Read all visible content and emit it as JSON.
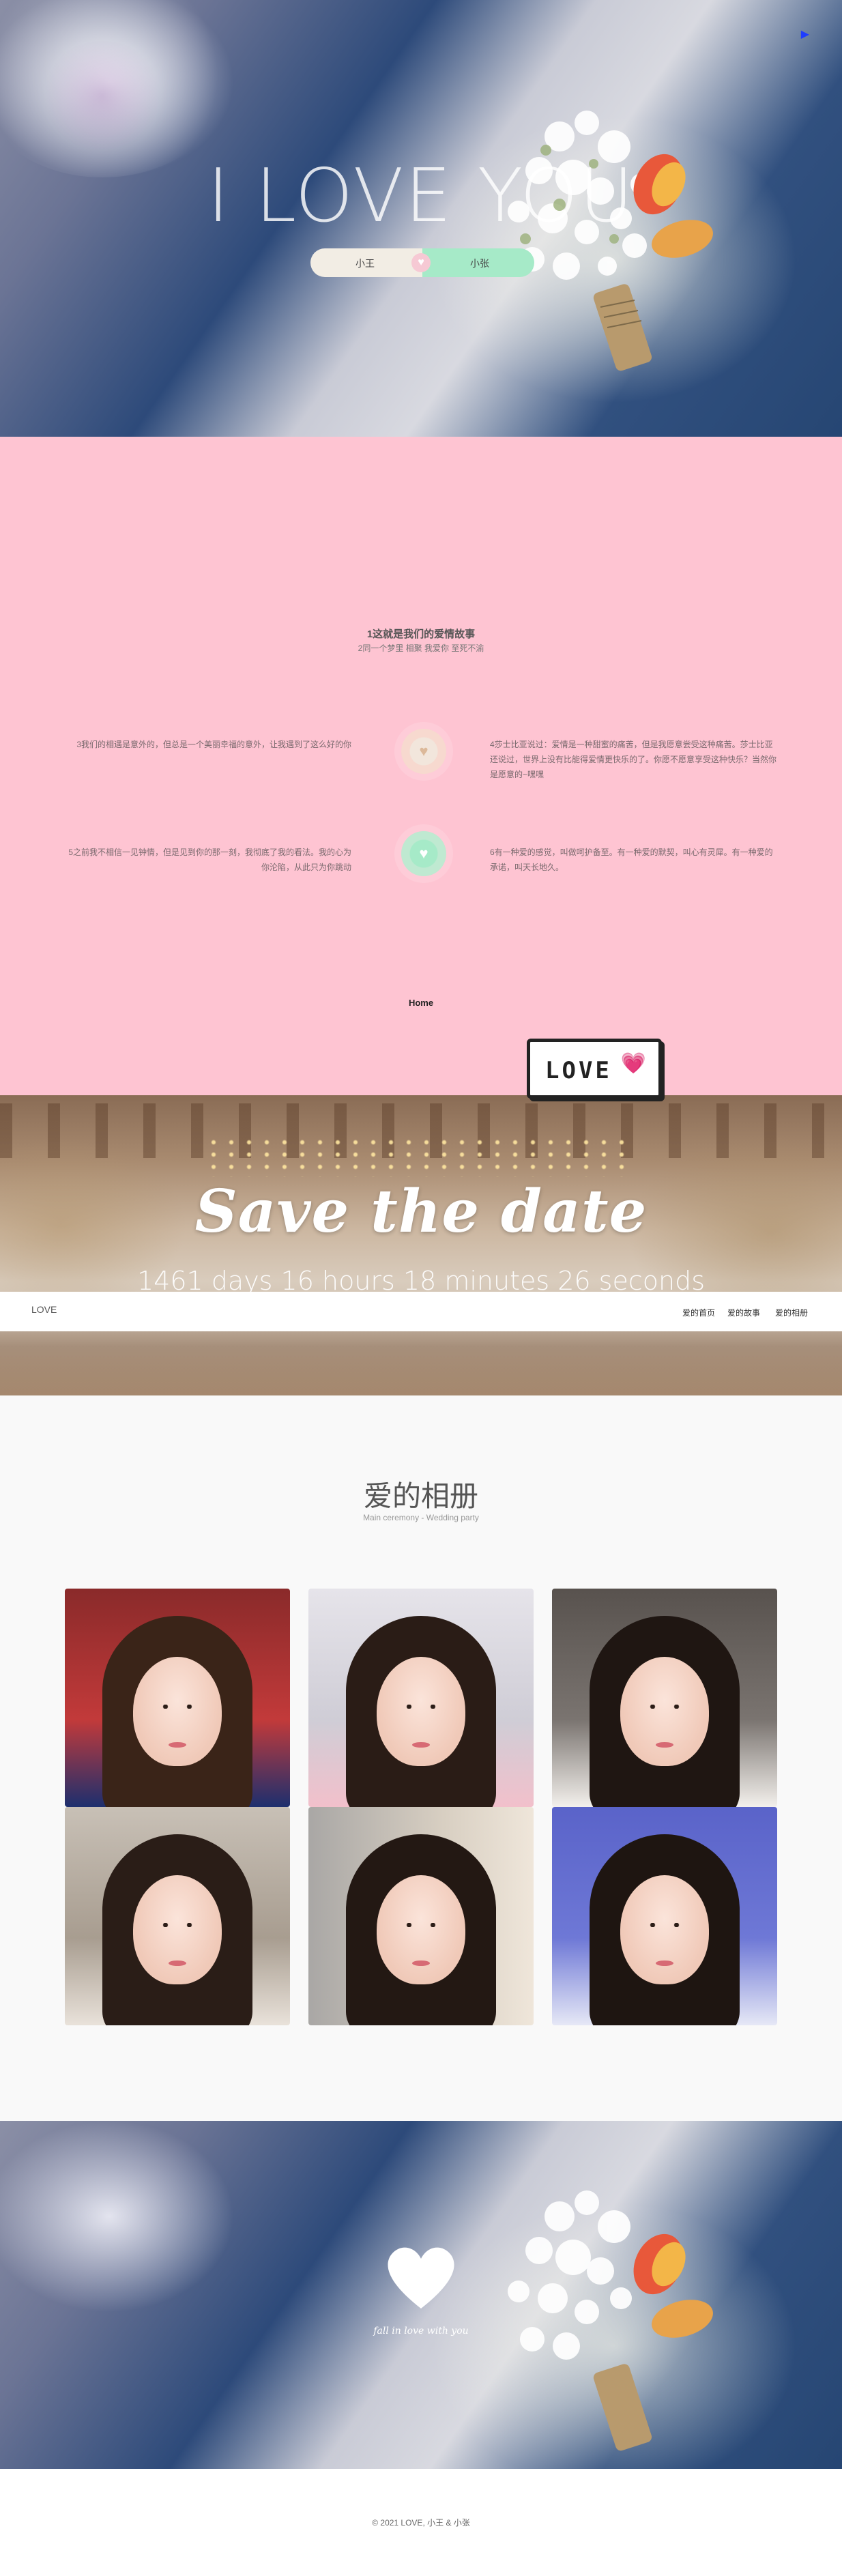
{
  "hero": {
    "title": "I LOVE YOU",
    "partner_left": "小王",
    "partner_right": "小张",
    "heart_glyph": "♥",
    "music_icon": "play-icon"
  },
  "story": {
    "title": "1这就是我们的爱情故事",
    "subtitle": "2同一个梦里 相聚 我爱你 至死不渝",
    "items": [
      "3我们的相遇是意外的，但总是一个美丽幸福的意外，让我遇到了这么好的你",
      "4莎士比亚说过：爱情是一种甜蜜的痛苦，但是我愿意尝受这种痛苦。莎士比亚还说过，世界上没有比能得爱情更快乐的了。你愿不愿意享受这种快乐？当然你是愿意的~嘿嘿",
      "5之前我不相信一见钟情，但是见到你的那一刻，我彻底了我的看法。我的心为你沦陷，从此只为你跳动",
      "6有一种爱的感觉，叫做呵护备至。有一种爱的默契，叫心有灵犀。有一种爱的承诺，叫天长地久。"
    ],
    "home_link": "Home",
    "love_badge": "LOVE",
    "badge_heart": "💗"
  },
  "save_date": {
    "title": "Save the date",
    "countdown": "1461 days 16 hours 18 minutes 26 seconds"
  },
  "nav": {
    "brand": "LOVE",
    "items": [
      "爱的首页",
      "爱的故事",
      "爱的相册"
    ]
  },
  "gallery": {
    "title": "爱的相册",
    "subtitle": "Main ceremony - Wedding party"
  },
  "closing": {
    "text": "fall in love with you"
  },
  "footer": {
    "copyright": "© 2021 LOVE, 小王 & 小张"
  },
  "colors": {
    "story_bg": "#fec4d2",
    "mint": "#a6eac8",
    "cream": "#f2ede4",
    "music_icon": "#1e3cff"
  }
}
